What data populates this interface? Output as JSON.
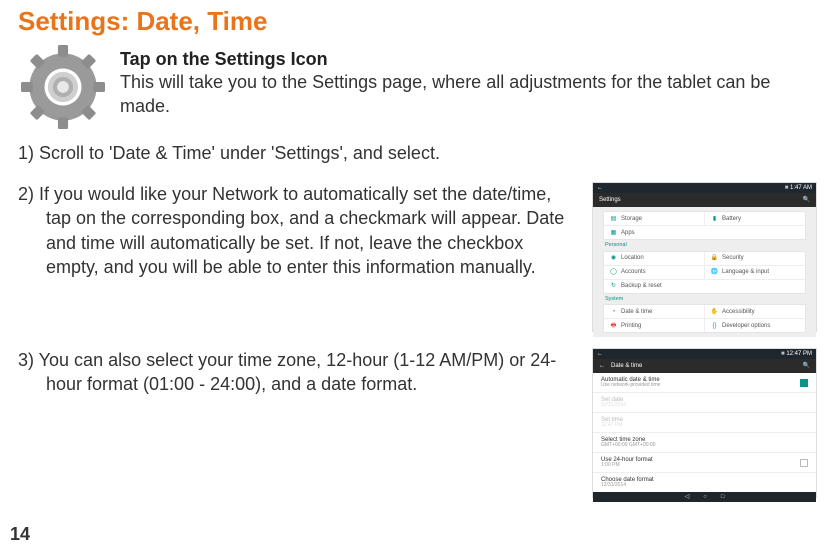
{
  "title": "Settings: Date, Time",
  "intro": {
    "heading": "Tap on the Settings Icon",
    "body": "This will take you to the Settings page, where all adjustments for the tablet can be made."
  },
  "steps": {
    "s1": "1) Scroll to 'Date & Time' under 'Settings', and select.",
    "s2": "2) If you would like your Network to automatically set the date/time, tap on the corresponding box, and a checkmark will appear.  Date and time will automatically be set.  If not, leave the checkbox empty, and you will be able to enter this information manually.",
    "s3": "3) You can also select your time zone, 12-hour (1-12 AM/PM) or 24-hour format (01:00 - 24:00), and a date format."
  },
  "shot1": {
    "time": "1:47 AM",
    "header": "Settings",
    "device": {
      "storage": "Storage",
      "battery": "Battery",
      "apps": "Apps"
    },
    "personal": {
      "header": "Personal",
      "location": "Location",
      "security": "Security",
      "accounts": "Accounts",
      "language": "Language & input",
      "backup": "Backup & reset"
    },
    "system": {
      "header": "System",
      "datetime": "Date & time",
      "accessibility": "Accessibility",
      "printing": "Printing",
      "developer": "Developer options"
    }
  },
  "shot2": {
    "time": "12:47 PM",
    "header": "Date & time",
    "auto": {
      "label": "Automatic date & time",
      "sub": "Use network-provided time"
    },
    "setdate": {
      "label": "Set date",
      "sub": "12/31/2014"
    },
    "settime": {
      "label": "Set time",
      "sub": "12:47 PM"
    },
    "tz": {
      "label": "Select time zone",
      "sub": "GMT+00:00 GMT+00:00"
    },
    "fmt24": {
      "label": "Use 24-hour format",
      "sub": "1:00 PM"
    },
    "datefmt": {
      "label": "Choose date format",
      "sub": "12/31/2014"
    }
  },
  "page": "14"
}
